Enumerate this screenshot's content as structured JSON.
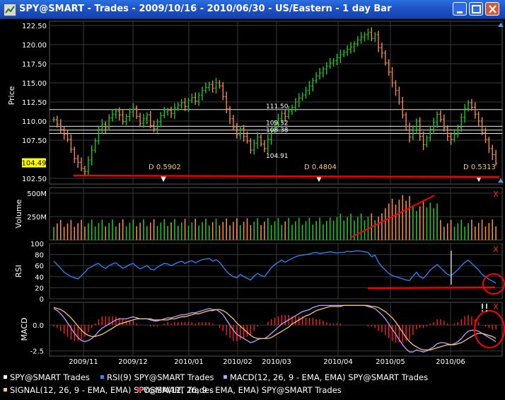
{
  "window": {
    "title": "SPY@SMART - Trades - 2009/10/16 - 2010/06/30 - US/Eastern - 1 day Bar",
    "controls": [
      "minimize-icon",
      "maximize-icon",
      "close-icon"
    ]
  },
  "colors": {
    "background": "#000000",
    "grid": "#3a3a3a",
    "up_bar": "#22c32a",
    "down_bar": "#f08c4a",
    "rsi_line": "#2f86ff",
    "macd_line": "#c59cff",
    "signal_line": "#f5c87a",
    "osma_hist": "#ff2020",
    "annotation": "#ff0000",
    "last_price_label_bg": "#ffff00"
  },
  "chart_data": [
    {
      "type": "ohlc",
      "panel": "price",
      "ylabel": "Price",
      "ylim": [
        102.5,
        122.5
      ],
      "yticks": [
        "122.50",
        "120.00",
        "117.50",
        "115.00",
        "112.50",
        "110.00",
        "107.50",
        "102.50"
      ],
      "last_price_label": "104.49",
      "x_ticks": [
        "2009/11",
        "2009/12",
        "2010/01",
        "2010/02",
        "2010/03",
        "2010/04",
        "2010/05",
        "2010/06"
      ],
      "closes": [
        110.2,
        109.6,
        108.9,
        108.3,
        107.6,
        106.3,
        105.1,
        104.6,
        103.8,
        103.4,
        104.9,
        106.2,
        107.4,
        108.9,
        109.6,
        109.1,
        110.4,
        110.9,
        111.3,
        110.8,
        109.9,
        110.6,
        111.2,
        111.7,
        110.6,
        109.7,
        110.3,
        110.8,
        109.4,
        109.0,
        109.9,
        110.7,
        111.2,
        111.4,
        111.0,
        111.7,
        112.1,
        112.4,
        111.9,
        112.7,
        113.1,
        112.6,
        113.4,
        114.0,
        114.4,
        114.8,
        114.3,
        115.0,
        114.6,
        113.2,
        111.6,
        110.3,
        109.1,
        108.2,
        109.0,
        108.0,
        107.4,
        106.2,
        107.1,
        107.9,
        107.0,
        106.4,
        107.6,
        108.7,
        109.6,
        110.3,
        111.0,
        110.6,
        111.3,
        111.8,
        112.5,
        113.0,
        113.4,
        114.0,
        114.6,
        115.3,
        115.9,
        116.3,
        116.8,
        117.2,
        117.6,
        117.9,
        118.3,
        118.7,
        119.0,
        119.4,
        119.7,
        120.1,
        120.6,
        121.0,
        121.3,
        121.6,
        120.8,
        121.3,
        119.6,
        118.9,
        117.6,
        116.4,
        115.0,
        114.0,
        112.5,
        110.8,
        109.3,
        107.9,
        108.8,
        110.0,
        108.0,
        106.9,
        107.8,
        108.9,
        109.8,
        110.9,
        110.2,
        109.1,
        108.0,
        107.6,
        108.3,
        109.2,
        110.5,
        111.6,
        112.4,
        111.8,
        110.9,
        110.0,
        108.5,
        107.6,
        106.4,
        105.6,
        104.5
      ],
      "annotations_text": [
        "111.50",
        "109.32",
        "108.38",
        "104.91",
        "D 0.5902",
        "D 0.4804",
        "D 0.5313"
      ]
    },
    {
      "type": "bar",
      "panel": "volume",
      "ylabel": "Volume",
      "yticks": [
        "250M",
        "500M"
      ],
      "ylim": [
        0,
        560
      ],
      "unit": "M"
    },
    {
      "type": "line",
      "panel": "rsi",
      "ylabel": "RSI",
      "yticks": [
        "100",
        "80",
        "60",
        "40",
        "20",
        "0"
      ],
      "ylim": [
        0,
        100
      ],
      "series": [
        {
          "name": "RSI(9)",
          "values": [
            68,
            62,
            55,
            48,
            44,
            40,
            38,
            36,
            42,
            48,
            55,
            58,
            62,
            64,
            58,
            55,
            60,
            63,
            65,
            60,
            55,
            58,
            62,
            64,
            58,
            54,
            57,
            60,
            54,
            52,
            57,
            61,
            64,
            63,
            60,
            63,
            66,
            68,
            64,
            67,
            69,
            65,
            68,
            71,
            72,
            73,
            68,
            71,
            66,
            58,
            50,
            44,
            40,
            38,
            44,
            40,
            37,
            34,
            41,
            46,
            42,
            40,
            48,
            56,
            62,
            66,
            70,
            66,
            70,
            73,
            76,
            78,
            79,
            80,
            81,
            83,
            84,
            82,
            83,
            84,
            85,
            84,
            83,
            84,
            84,
            86,
            85,
            86,
            87,
            86,
            85,
            84,
            76,
            79,
            66,
            58,
            52,
            46,
            42,
            40,
            38,
            36,
            34,
            33,
            41,
            48,
            40,
            37,
            44,
            52,
            57,
            62,
            56,
            50,
            44,
            42,
            47,
            53,
            60,
            66,
            70,
            64,
            58,
            52,
            44,
            40,
            35,
            32,
            28
          ]
        }
      ]
    },
    {
      "type": "line",
      "panel": "macd",
      "ylabel": "MACD",
      "yticks": [
        "0.0",
        "-2.5"
      ],
      "ylim": [
        -3.0,
        2.2
      ],
      "series": [
        {
          "name": "MACD(12, 26, 9 - EMA, EMA)",
          "values": [
            1.6,
            1.4,
            1.1,
            0.7,
            0.2,
            -0.3,
            -0.8,
            -1.2,
            -1.5,
            -1.6,
            -1.5,
            -1.3,
            -1.0,
            -0.6,
            -0.3,
            -0.1,
            0.1,
            0.3,
            0.5,
            0.6,
            0.6,
            0.6,
            0.7,
            0.8,
            0.7,
            0.6,
            0.6,
            0.6,
            0.5,
            0.4,
            0.4,
            0.5,
            0.6,
            0.7,
            0.7,
            0.8,
            0.9,
            1.0,
            1.0,
            1.1,
            1.2,
            1.2,
            1.3,
            1.4,
            1.5,
            1.6,
            1.5,
            1.5,
            1.3,
            1.0,
            0.5,
            0.0,
            -0.5,
            -0.9,
            -1.1,
            -1.3,
            -1.5,
            -1.7,
            -1.6,
            -1.4,
            -1.3,
            -1.3,
            -1.1,
            -0.8,
            -0.5,
            -0.2,
            0.1,
            0.3,
            0.5,
            0.7,
            0.9,
            1.1,
            1.3,
            1.4,
            1.5,
            1.7,
            1.8,
            1.9,
            1.9,
            1.9,
            1.9,
            1.9,
            1.9,
            1.9,
            1.9,
            1.9,
            1.9,
            1.9,
            1.9,
            1.9,
            1.9,
            1.8,
            1.7,
            1.6,
            1.3,
            1.0,
            0.6,
            0.1,
            -0.4,
            -0.9,
            -1.4,
            -1.9,
            -2.3,
            -2.6,
            -2.6,
            -2.4,
            -2.5,
            -2.6,
            -2.5,
            -2.3,
            -2.1,
            -1.8,
            -1.7,
            -1.7,
            -1.8,
            -1.9,
            -1.8,
            -1.6,
            -1.3,
            -0.9,
            -0.6,
            -0.5,
            -0.5,
            -0.6,
            -0.8,
            -1.0,
            -1.2,
            -1.4,
            -1.6
          ]
        },
        {
          "name": "SIGNAL(12, 26, 9 - EMA, EMA)",
          "values": [
            1.7,
            1.6,
            1.5,
            1.3,
            1.0,
            0.7,
            0.3,
            -0.1,
            -0.5,
            -0.8,
            -1.0,
            -1.1,
            -1.1,
            -1.0,
            -0.9,
            -0.7,
            -0.5,
            -0.3,
            -0.1,
            0.1,
            0.2,
            0.3,
            0.4,
            0.5,
            0.6,
            0.6,
            0.6,
            0.6,
            0.6,
            0.5,
            0.5,
            0.5,
            0.5,
            0.5,
            0.6,
            0.6,
            0.7,
            0.8,
            0.8,
            0.9,
            1.0,
            1.1,
            1.1,
            1.2,
            1.3,
            1.4,
            1.4,
            1.5,
            1.5,
            1.4,
            1.2,
            0.9,
            0.6,
            0.2,
            -0.1,
            -0.4,
            -0.7,
            -1.0,
            -1.2,
            -1.3,
            -1.3,
            -1.3,
            -1.3,
            -1.2,
            -1.0,
            -0.8,
            -0.6,
            -0.4,
            -0.2,
            0.1,
            0.3,
            0.5,
            0.7,
            0.9,
            1.0,
            1.2,
            1.4,
            1.5,
            1.6,
            1.7,
            1.8,
            1.8,
            1.8,
            1.8,
            1.9,
            1.9,
            1.9,
            1.9,
            1.9,
            1.9,
            1.9,
            1.9,
            1.8,
            1.8,
            1.7,
            1.5,
            1.3,
            1.0,
            0.7,
            0.3,
            -0.2,
            -0.7,
            -1.2,
            -1.6,
            -1.9,
            -2.1,
            -2.3,
            -2.4,
            -2.4,
            -2.4,
            -2.3,
            -2.2,
            -2.1,
            -2.0,
            -1.9,
            -1.9,
            -1.9,
            -1.8,
            -1.7,
            -1.5,
            -1.3,
            -1.1,
            -0.9,
            -0.8,
            -0.8,
            -0.9,
            -1.0,
            -1.1,
            -1.3
          ]
        }
      ]
    }
  ],
  "legend": [
    {
      "label": "SPY@SMART Trades",
      "color": "#ffffff"
    },
    {
      "label": "RSI(9) SPY@SMART Trades",
      "color": "#2f86ff"
    },
    {
      "label": "MACD(12, 26, 9 - EMA, EMA) SPY@SMART Trades",
      "color": "#c59cff"
    },
    {
      "label": "SIGNAL(12, 26, 9 - EMA, EMA) SPY@SMART Trades",
      "color": "#f5c87a"
    },
    {
      "label": "OSMA(12, 26, 9 - EMA, EMA) SPY@SMART Trades",
      "color": "#ff2020"
    }
  ],
  "marker_text": "!!",
  "close_panel_glyph": "X"
}
